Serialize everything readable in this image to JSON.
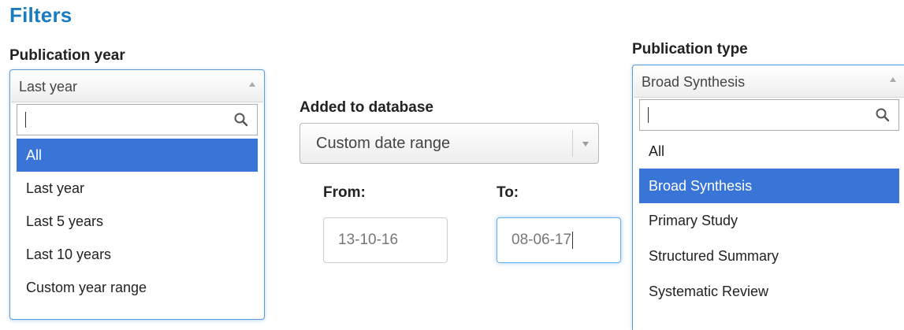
{
  "filters": {
    "heading": "Filters"
  },
  "publication_year": {
    "label": "Publication year",
    "selected": "Last year",
    "search_value": "",
    "options": [
      "All",
      "Last year",
      "Last 5 years",
      "Last 10 years",
      "Custom year range"
    ],
    "highlighted": "All"
  },
  "added_to_database": {
    "label": "Added to database",
    "selected": "Custom date range",
    "from_label": "From:",
    "to_label": "To:",
    "from_value": "13-10-16",
    "to_value": "08-06-17"
  },
  "publication_type": {
    "label": "Publication type",
    "selected": "Broad Synthesis",
    "search_value": "",
    "options": [
      "All",
      "Broad Synthesis",
      "Primary Study",
      "Structured Summary",
      "Systematic Review"
    ],
    "highlighted": "Broad Synthesis"
  },
  "colors": {
    "heading": "#1a7bbf",
    "highlight": "#3875d7",
    "focus_border": "#5b9dd9"
  },
  "icons": {
    "search": "magnifier-icon",
    "dropdown_up": "triangle-up",
    "dropdown_down": "triangle-down"
  }
}
